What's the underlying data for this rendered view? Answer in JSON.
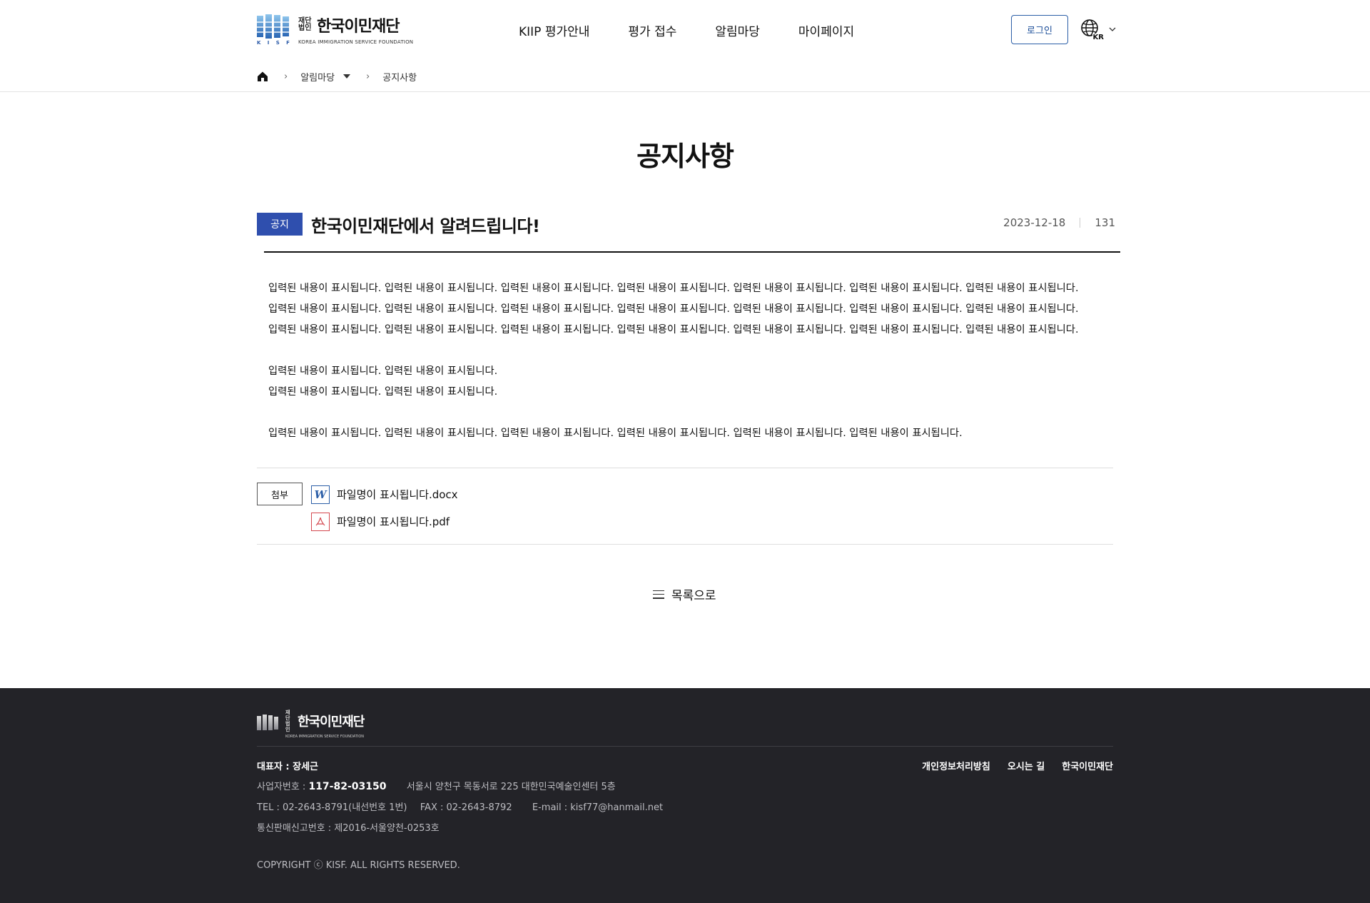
{
  "header": {
    "logo": {
      "small_text": "재단법인",
      "name": "한국이민재단",
      "english": "KOREA IMMIGRATION SERVICE FOUNDATION",
      "mark_letters": [
        "K",
        "I",
        "S",
        "F"
      ]
    },
    "nav": [
      "KIIP 평가안내",
      "평가 접수",
      "알림마당",
      "마이페이지"
    ],
    "login_label": "로그인",
    "language": "KR",
    "language_icon": "globe-icon"
  },
  "breadcrumb": {
    "home_icon": "home-icon",
    "section": "알림마당",
    "current": "공지사항"
  },
  "page_title": "공지사항",
  "post": {
    "badge": "공지",
    "title": "한국이민재단에서 알려드립니다!",
    "date": "2023-12-18",
    "views": "131",
    "body_lines": [
      "입력된 내용이 표시됩니다. 입력된 내용이 표시됩니다. 입력된 내용이 표시됩니다. 입력된 내용이 표시됩니다. 입력된 내용이 표시됩니다. 입력된 내용이 표시됩니다. 입력된 내용이 표시됩니다.",
      "입력된 내용이 표시됩니다. 입력된 내용이 표시됩니다. 입력된 내용이 표시됩니다. 입력된 내용이 표시됩니다. 입력된 내용이 표시됩니다. 입력된 내용이 표시됩니다. 입력된 내용이 표시됩니다.",
      "입력된 내용이 표시됩니다. 입력된 내용이 표시됩니다. 입력된 내용이 표시됩니다. 입력된 내용이 표시됩니다. 입력된 내용이 표시됩니다. 입력된 내용이 표시됩니다. 입력된 내용이 표시됩니다.",
      "입력된 내용이 표시됩니다. 입력된 내용이 표시됩니다.",
      "입력된 내용이 표시됩니다. 입력된 내용이 표시됩니다.",
      "입력된 내용이 표시됩니다. 입력된 내용이 표시됩니다. 입력된 내용이 표시됩니다. 입력된 내용이 표시됩니다. 입력된 내용이 표시됩니다. 입력된 내용이 표시됩니다."
    ],
    "attachment_label": "첨부",
    "attachments": [
      {
        "icon": "word-file-icon",
        "glyph": "W",
        "name": "파일명이 표시됩니다.docx"
      },
      {
        "icon": "pdf-file-icon",
        "glyph": "⅄",
        "name": "파일명이 표시됩니다.pdf"
      }
    ],
    "list_button": "목록으로"
  },
  "footer": {
    "logo_small": "재단법인",
    "logo_name": "한국이민재단",
    "logo_english": "KOREA IMMIGRATION SERVICE FOUNDATION",
    "ceo": "대표자 : 장세근",
    "links": [
      "개인정보처리방침",
      "오시는 길",
      "한국이민재단"
    ],
    "biz_label": "사업자번호 :",
    "biz_number": "117-82-03150",
    "address": "서울시 양천구 목동서로 225 대한민국예술인센터 5층",
    "tel": "TEL : 02-2643-8791(내선번호 1번)",
    "fax": "FAX : 02-2643-8792",
    "email": "E-mail : kisf77@hanmail.net",
    "mail_order": "통신판매신고번호 : 제2016-서울양천-0253호",
    "copyright": "COPYRIGHT ⓒ KISF. ALL RIGHTS RESERVED."
  },
  "colors": {
    "accent": "#2f4fae",
    "login_border": "#2b5ea7",
    "footer_bg": "#232328",
    "pdf_red": "#d4484f"
  }
}
